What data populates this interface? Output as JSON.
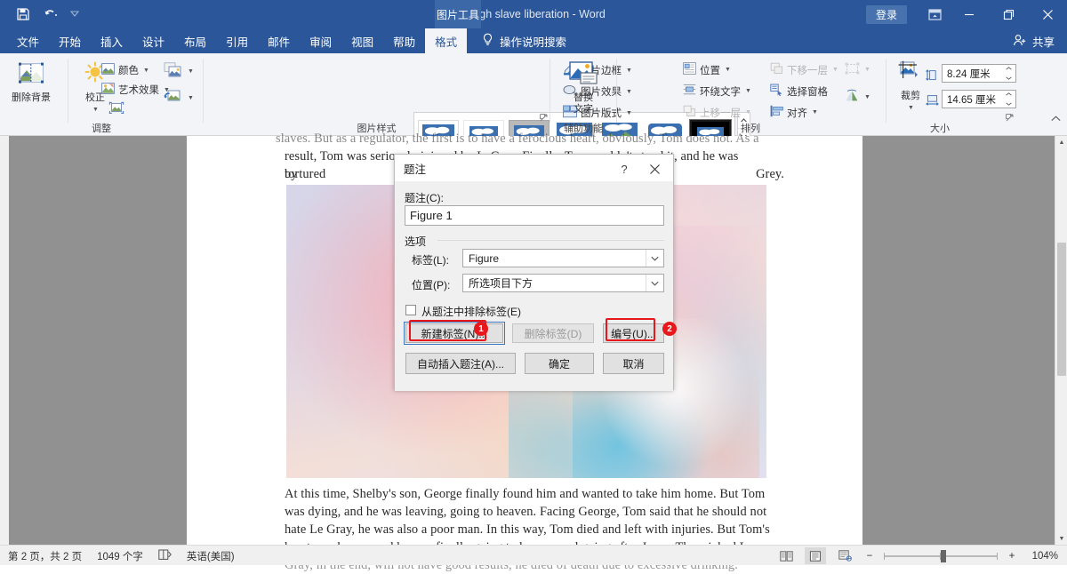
{
  "titlebar": {
    "document_title": "Tough slave liberation  -  Word",
    "contextual_tab_group": "图片工具",
    "signin": "登录",
    "icons": [
      "save-icon",
      "undo-icon",
      "customize-qat-icon"
    ],
    "window_buttons": [
      "ribbon-display-options",
      "minimize",
      "restore",
      "close"
    ]
  },
  "tabs": {
    "items": [
      {
        "label": "文件",
        "active": false
      },
      {
        "label": "开始",
        "active": false
      },
      {
        "label": "插入",
        "active": false
      },
      {
        "label": "设计",
        "active": false
      },
      {
        "label": "布局",
        "active": false
      },
      {
        "label": "引用",
        "active": false
      },
      {
        "label": "邮件",
        "active": false
      },
      {
        "label": "审阅",
        "active": false
      },
      {
        "label": "视图",
        "active": false
      },
      {
        "label": "帮助",
        "active": false
      },
      {
        "label": "格式",
        "active": true
      }
    ],
    "tell_me": "操作说明搜索",
    "share": "共享"
  },
  "ribbon": {
    "groups": [
      {
        "name": "调整",
        "label": "调整",
        "big_buttons": [
          {
            "label": "删除背景",
            "icon": "remove-background-icon"
          },
          {
            "label": "校正",
            "icon": "corrections-icon",
            "has_caret": true
          }
        ],
        "small_items": [
          {
            "label": "颜色",
            "icon": "color-icon",
            "caret": true
          },
          {
            "label": "艺术效果",
            "icon": "artistic-effects-icon",
            "caret": true
          },
          {
            "label": "压缩图片",
            "icon": "compress-pictures-icon",
            "caret": false
          },
          {
            "label": "更改图片",
            "icon": "change-picture-icon",
            "caret": true
          },
          {
            "label": "重设图片",
            "icon": "reset-picture-icon",
            "caret": true
          }
        ]
      },
      {
        "name": "图片样式",
        "label": "图片样式",
        "gallery_count": 7,
        "gallery_selected_index": 6,
        "small_items": [
          {
            "label": "图片边框",
            "icon": "picture-border-icon",
            "caret": true
          },
          {
            "label": "图片效果",
            "icon": "picture-effects-icon",
            "caret": true
          },
          {
            "label": "图片版式",
            "icon": "picture-layout-icon",
            "caret": true
          }
        ]
      },
      {
        "name": "辅助功能",
        "label": "辅助功能",
        "big_buttons": [
          {
            "label": "替换\n文字",
            "icon": "alt-text-icon"
          }
        ]
      },
      {
        "name": "排列",
        "label": "排列",
        "small_items": [
          {
            "label": "位置",
            "icon": "position-icon",
            "caret": true,
            "disabled": false
          },
          {
            "label": "环绕文字",
            "icon": "wrap-text-icon",
            "caret": true,
            "disabled": false
          },
          {
            "label": "上移一层",
            "icon": "bring-forward-icon",
            "caret": true,
            "disabled": true
          },
          {
            "label": "下移一层",
            "icon": "send-backward-icon",
            "caret": true,
            "disabled": true
          },
          {
            "label": "选择窗格",
            "icon": "selection-pane-icon",
            "caret": false,
            "disabled": false
          },
          {
            "label": "对齐",
            "icon": "align-icon",
            "caret": true,
            "disabled": false
          },
          {
            "label": "组合",
            "icon": "group-icon",
            "caret": true,
            "disabled": true
          },
          {
            "label": "旋转",
            "icon": "rotate-icon",
            "caret": true,
            "disabled": false
          }
        ]
      },
      {
        "name": "大小",
        "label": "大小",
        "big_buttons": [
          {
            "label": "裁剪",
            "icon": "crop-icon",
            "has_caret": true
          }
        ],
        "height_value": "8.24 厘米",
        "width_value": "14.65 厘米",
        "height_icon": "shape-height-icon",
        "width_icon": "shape-width-icon"
      }
    ],
    "collapse_icon": "collapse-ribbon-icon"
  },
  "document": {
    "text_above_1": "slaves. But as a regulator, the first is to have a ferocious heart, obviously, Tom does not. As a",
    "text_above_2": "result, Tom was seriously injured by LeGray. Finally, Tom couldn't stand it, and he was tortured",
    "text_above_3_left": "by",
    "text_above_3_right": "Grey.",
    "image_alt": "pastel-portrait-photo",
    "text_below": [
      "At this time, Shelby's son, George finally found him and wanted to take him home. But Tom",
      "was dying, and he was leaving, going to heaven. Facing George, Tom said that he should not",
      "hate Le Gray, he was also a poor man. In this way, Tom died and left with injuries. But Tom's",
      "heart was happy, and he was finally going to heaven and going after Jesus. The wicked Le",
      "Gray, in the end, will not have good results, he died of death due to excessive drinking."
    ]
  },
  "dialog": {
    "title": "题注",
    "help_glyph": "?",
    "close_glyph": "✕",
    "caption_label": "题注(C):",
    "caption_value": "Figure 1",
    "options_group_label": "选项",
    "label_label": "标签(L):",
    "label_value": "Figure",
    "position_label": "位置(P):",
    "position_value": "所选项目下方",
    "exclude_checkbox_label": "从题注中排除标签(E)",
    "exclude_checked": false,
    "buttons": {
      "new_label": "新建标签(N)...",
      "delete_label": "删除标签(D)",
      "numbering": "编号(U)...",
      "autocaption": "自动插入题注(A)...",
      "ok": "确定",
      "cancel": "取消"
    }
  },
  "annotations": [
    {
      "number": "1",
      "target": "new-label-button",
      "color": "#e8171b"
    },
    {
      "number": "2",
      "target": "numbering-button",
      "color": "#e8171b"
    }
  ],
  "statusbar": {
    "page_info": "第 2 页，共 2 页",
    "word_count": "1049 个字",
    "proofing_icon": "proofing-errors-icon",
    "language": "英语(美国)",
    "view_buttons": [
      "read-mode-icon",
      "print-layout-icon",
      "web-layout-icon"
    ],
    "active_view_index": 1,
    "zoom_out": "−",
    "zoom_in": "+",
    "zoom_level": "104%"
  }
}
